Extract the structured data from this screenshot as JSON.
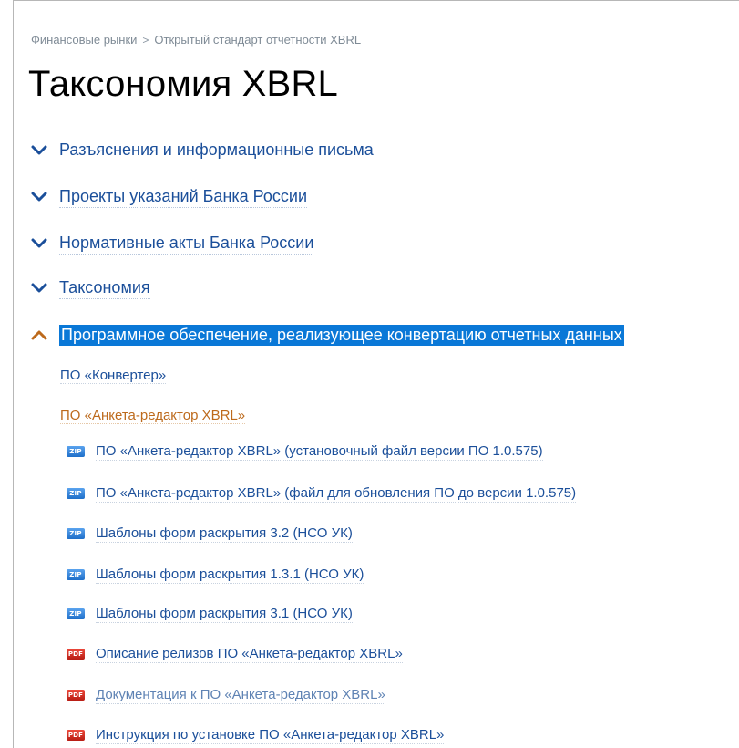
{
  "breadcrumb": {
    "items": [
      "Финансовые рынки",
      "Открытый стандарт отчетности XBRL"
    ],
    "separator": ">"
  },
  "page": {
    "title": "Таксономия XBRL"
  },
  "sections": [
    {
      "label": "Разъяснения и информационные письма",
      "expanded": false
    },
    {
      "label": "Проекты указаний Банка России",
      "expanded": false
    },
    {
      "label": "Нормативные акты Банка России",
      "expanded": false
    },
    {
      "label": "Таксономия",
      "expanded": false
    },
    {
      "label": "Программное обеспечение, реализующее конвертацию отчетных данных",
      "expanded": true
    }
  ],
  "subsections": [
    {
      "label": "ПО «Конвертер»",
      "state": "collapsed"
    },
    {
      "label": "ПО «Анкета-редактор XBRL»",
      "state": "expanded"
    }
  ],
  "files": [
    {
      "type": "zip",
      "badge": "ZIP",
      "label": "ПО «Анкета-редактор XBRL» (установочный файл версии ПО 1.0.575)"
    },
    {
      "type": "zip",
      "badge": "ZIP",
      "label": "ПО «Анкета-редактор XBRL» (файл для обновления ПО до версии 1.0.575)"
    },
    {
      "type": "zip",
      "badge": "ZIP",
      "label": "Шаблоны форм раскрытия 3.2 (НСО УК)"
    },
    {
      "type": "zip",
      "badge": "ZIP",
      "label": "Шаблоны форм раскрытия 1.3.1 (НСО УК)"
    },
    {
      "type": "zip",
      "badge": "ZIP",
      "label": "Шаблоны форм раскрытия 3.1 (НСО УК)"
    },
    {
      "type": "pdf",
      "badge": "PDF",
      "label": "Описание релизов ПО «Анкета-редактор XBRL»"
    },
    {
      "type": "pdf",
      "badge": "PDF",
      "label": "Документация к ПО «Анкета-редактор XBRL»"
    },
    {
      "type": "pdf",
      "badge": "PDF",
      "label": "Инструкция по установке ПО «Анкета-редактор XBRL»"
    }
  ],
  "colors": {
    "link": "#1b4f9a",
    "accent_orange": "#bd6a1c",
    "selection": "#0a78d7",
    "zip_badge": "#2a7fd8",
    "pdf_badge": "#d4281c"
  },
  "icons": {
    "collapsed": "chevron-down-icon",
    "expanded": "chevron-up-icon",
    "zip": "zip-file-icon",
    "pdf": "pdf-file-icon"
  }
}
